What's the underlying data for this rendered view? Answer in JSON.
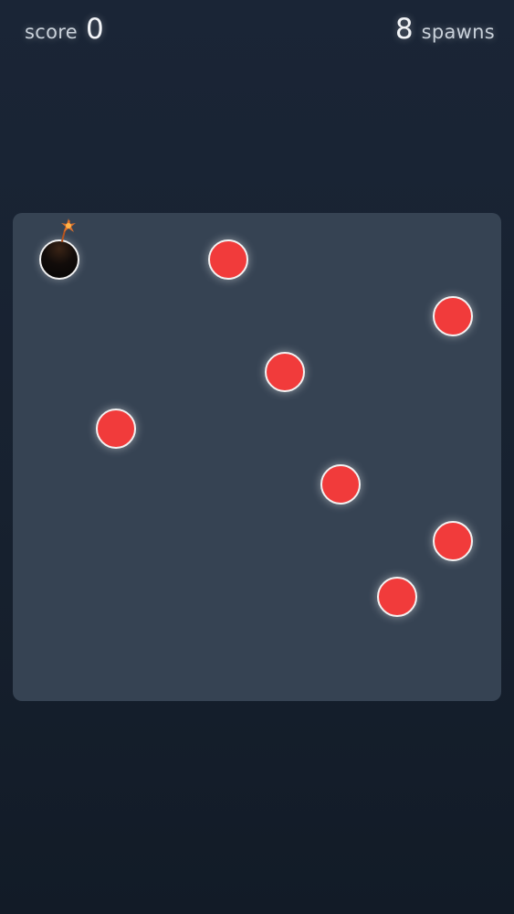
{
  "hud": {
    "score_label": "score",
    "score_value": "0",
    "spawns_value": "8",
    "spawns_label": "spawns"
  },
  "colors": {
    "background": "#17212f",
    "board": "#364353",
    "dot": "#f13b3b",
    "dot_border": "#f2f2f2",
    "bomb": "#050505",
    "fuse_spark": "#e8742a"
  },
  "board": {
    "dot_count": 8,
    "has_bomb": true
  }
}
